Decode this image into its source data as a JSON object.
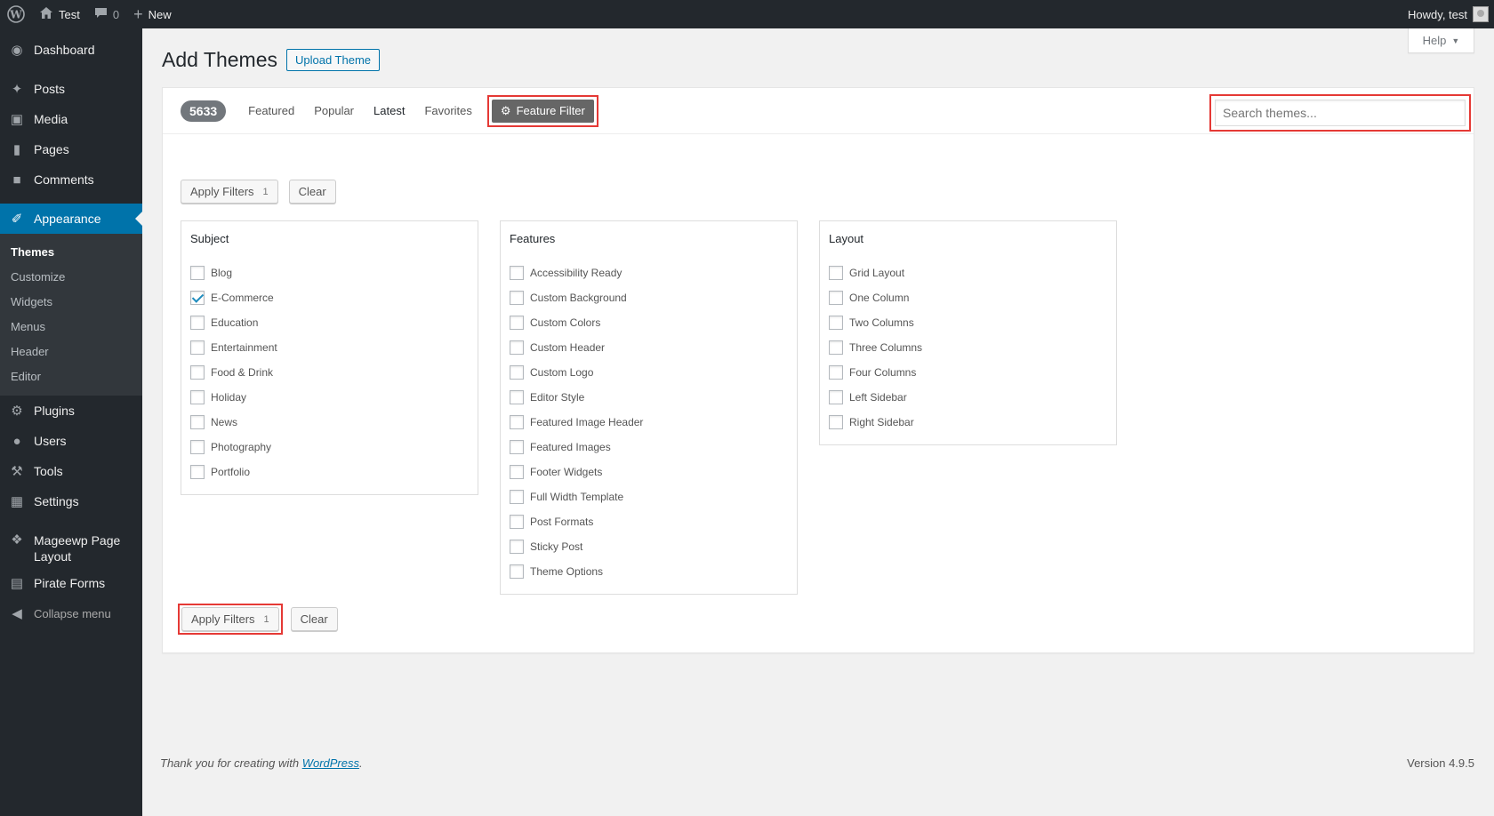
{
  "adminbar": {
    "site_name": "Test",
    "comments_count": "0",
    "new_label": "New",
    "howdy": "Howdy, test"
  },
  "sidebar": {
    "items": [
      {
        "label": "Dashboard",
        "icon": "dashboard-icon"
      },
      {
        "label": "Posts",
        "icon": "pin-icon"
      },
      {
        "label": "Media",
        "icon": "media-icon"
      },
      {
        "label": "Pages",
        "icon": "pages-icon"
      },
      {
        "label": "Comments",
        "icon": "comment-icon"
      },
      {
        "label": "Appearance",
        "icon": "brush-icon"
      },
      {
        "label": "Plugins",
        "icon": "plugin-icon"
      },
      {
        "label": "Users",
        "icon": "user-icon"
      },
      {
        "label": "Tools",
        "icon": "wrench-icon"
      },
      {
        "label": "Settings",
        "icon": "settings-icon"
      },
      {
        "label": "Mageewp Page Layout",
        "icon": "butterfly-icon"
      },
      {
        "label": "Pirate Forms",
        "icon": "form-icon"
      },
      {
        "label": "Collapse menu",
        "icon": "collapse-icon"
      }
    ],
    "appearance_submenu": [
      "Themes",
      "Customize",
      "Widgets",
      "Menus",
      "Header",
      "Editor"
    ]
  },
  "header": {
    "help_label": "Help",
    "page_title": "Add Themes",
    "upload_label": "Upload Theme"
  },
  "filterbar": {
    "count": "5633",
    "links": [
      "Featured",
      "Popular",
      "Latest",
      "Favorites"
    ],
    "feature_filter_label": "Feature Filter",
    "search_placeholder": "Search themes..."
  },
  "actions": {
    "apply_label": "Apply Filters",
    "apply_count": "1",
    "clear_label": "Clear"
  },
  "groups": {
    "subject": {
      "title": "Subject",
      "items": [
        "Blog",
        "E-Commerce",
        "Education",
        "Entertainment",
        "Food & Drink",
        "Holiday",
        "News",
        "Photography",
        "Portfolio"
      ],
      "checked": [
        "E-Commerce"
      ]
    },
    "features": {
      "title": "Features",
      "items": [
        "Accessibility Ready",
        "Custom Background",
        "Custom Colors",
        "Custom Header",
        "Custom Logo",
        "Editor Style",
        "Featured Image Header",
        "Featured Images",
        "Footer Widgets",
        "Full Width Template",
        "Post Formats",
        "Sticky Post",
        "Theme Options"
      ]
    },
    "layout": {
      "title": "Layout",
      "items": [
        "Grid Layout",
        "One Column",
        "Two Columns",
        "Three Columns",
        "Four Columns",
        "Left Sidebar",
        "Right Sidebar"
      ]
    }
  },
  "footer": {
    "thanks_prefix": "Thank you for creating with ",
    "wordpress_link": "WordPress",
    "thanks_suffix": ".",
    "version": "Version 4.9.5"
  },
  "colors": {
    "adminbar_bg": "#23282d",
    "accent": "#0073aa",
    "highlight": "#e53935"
  }
}
